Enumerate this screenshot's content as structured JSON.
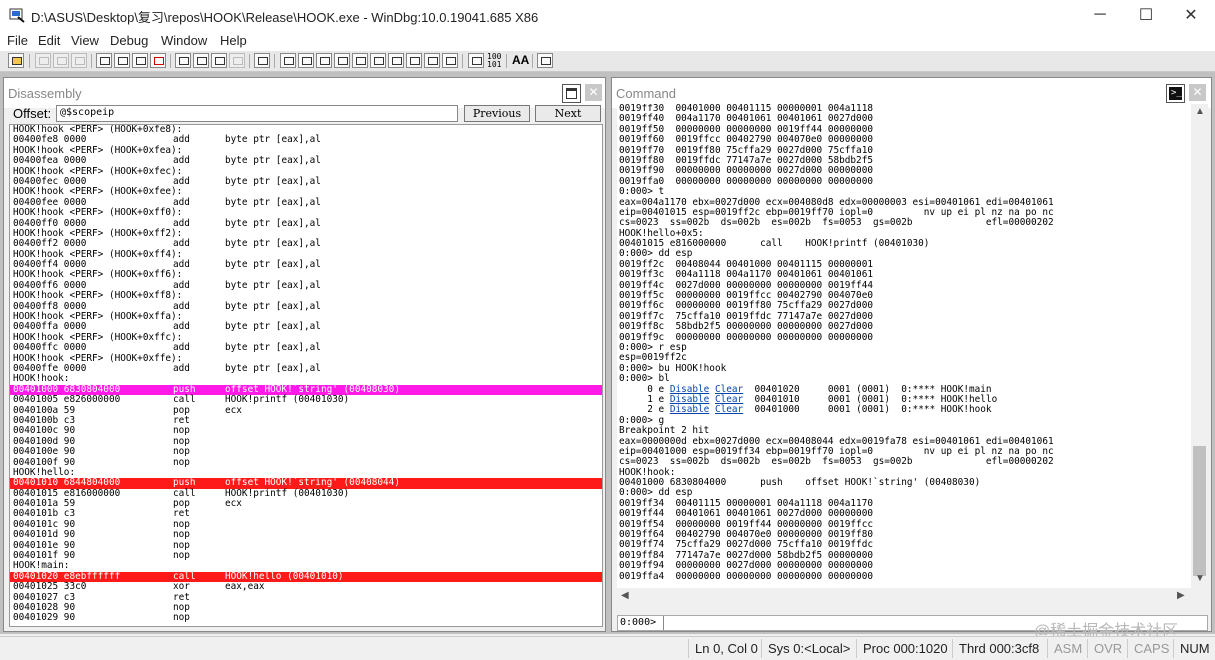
{
  "title": "D:\\ASUS\\Desktop\\复习\\repos\\HOOK\\Release\\HOOK.exe - WinDbg:10.0.19041.685 X86",
  "window_controls": {
    "minimize": "─",
    "maximize": "☐",
    "close": "✕"
  },
  "menu": [
    "File",
    "Edit",
    "View",
    "Debug",
    "Window",
    "Help"
  ],
  "toolbar_text": {
    "binary_top": "100",
    "binary_bottom": "101",
    "font_button": "AA"
  },
  "disassembly": {
    "title": "Disassembly",
    "offset_label": "Offset:",
    "offset_value": "@$scopeip",
    "previous_label": "Previous",
    "next_label": "Next",
    "lines": [
      {
        "t": "label",
        "text": "HOOK!hook <PERF> (HOOK+0xfe8):"
      },
      {
        "t": "code",
        "addr": "00400fe8 0000",
        "mn": "add",
        "op": "byte ptr [eax],al"
      },
      {
        "t": "label",
        "text": "HOOK!hook <PERF> (HOOK+0xfea):"
      },
      {
        "t": "code",
        "addr": "00400fea 0000",
        "mn": "add",
        "op": "byte ptr [eax],al"
      },
      {
        "t": "label",
        "text": "HOOK!hook <PERF> (HOOK+0xfec):"
      },
      {
        "t": "code",
        "addr": "00400fec 0000",
        "mn": "add",
        "op": "byte ptr [eax],al"
      },
      {
        "t": "label",
        "text": "HOOK!hook <PERF> (HOOK+0xfee):"
      },
      {
        "t": "code",
        "addr": "00400fee 0000",
        "mn": "add",
        "op": "byte ptr [eax],al"
      },
      {
        "t": "label",
        "text": "HOOK!hook <PERF> (HOOK+0xff0):"
      },
      {
        "t": "code",
        "addr": "00400ff0 0000",
        "mn": "add",
        "op": "byte ptr [eax],al"
      },
      {
        "t": "label",
        "text": "HOOK!hook <PERF> (HOOK+0xff2):"
      },
      {
        "t": "code",
        "addr": "00400ff2 0000",
        "mn": "add",
        "op": "byte ptr [eax],al"
      },
      {
        "t": "label",
        "text": "HOOK!hook <PERF> (HOOK+0xff4):"
      },
      {
        "t": "code",
        "addr": "00400ff4 0000",
        "mn": "add",
        "op": "byte ptr [eax],al"
      },
      {
        "t": "label",
        "text": "HOOK!hook <PERF> (HOOK+0xff6):"
      },
      {
        "t": "code",
        "addr": "00400ff6 0000",
        "mn": "add",
        "op": "byte ptr [eax],al"
      },
      {
        "t": "label",
        "text": "HOOK!hook <PERF> (HOOK+0xff8):"
      },
      {
        "t": "code",
        "addr": "00400ff8 0000",
        "mn": "add",
        "op": "byte ptr [eax],al"
      },
      {
        "t": "label",
        "text": "HOOK!hook <PERF> (HOOK+0xffa):"
      },
      {
        "t": "code",
        "addr": "00400ffa 0000",
        "mn": "add",
        "op": "byte ptr [eax],al"
      },
      {
        "t": "label",
        "text": "HOOK!hook <PERF> (HOOK+0xffc):"
      },
      {
        "t": "code",
        "addr": "00400ffc 0000",
        "mn": "add",
        "op": "byte ptr [eax],al"
      },
      {
        "t": "label",
        "text": "HOOK!hook <PERF> (HOOK+0xffe):"
      },
      {
        "t": "code",
        "addr": "00400ffe 0000",
        "mn": "add",
        "op": "byte ptr [eax],al"
      },
      {
        "t": "label",
        "text": "HOOK!hook:"
      },
      {
        "t": "code",
        "hl": "mag",
        "addr": "00401000 6830804000",
        "mn": "push",
        "op": "offset HOOK!`string' (00408030)"
      },
      {
        "t": "code",
        "addr": "00401005 e826000000",
        "mn": "call",
        "op": "HOOK!printf (00401030)"
      },
      {
        "t": "code",
        "addr": "0040100a 59",
        "mn": "pop",
        "op": "ecx"
      },
      {
        "t": "code",
        "addr": "0040100b c3",
        "mn": "ret",
        "op": ""
      },
      {
        "t": "code",
        "addr": "0040100c 90",
        "mn": "nop",
        "op": ""
      },
      {
        "t": "code",
        "addr": "0040100d 90",
        "mn": "nop",
        "op": ""
      },
      {
        "t": "code",
        "addr": "0040100e 90",
        "mn": "nop",
        "op": ""
      },
      {
        "t": "code",
        "addr": "0040100f 90",
        "mn": "nop",
        "op": ""
      },
      {
        "t": "label",
        "text": "HOOK!hello:"
      },
      {
        "t": "code",
        "hl": "red",
        "addr": "00401010 6844804000",
        "mn": "push",
        "op": "offset HOOK!`string' (00408044)"
      },
      {
        "t": "code",
        "addr": "00401015 e816000000",
        "mn": "call",
        "op": "HOOK!printf (00401030)"
      },
      {
        "t": "code",
        "addr": "0040101a 59",
        "mn": "pop",
        "op": "ecx"
      },
      {
        "t": "code",
        "addr": "0040101b c3",
        "mn": "ret",
        "op": ""
      },
      {
        "t": "code",
        "addr": "0040101c 90",
        "mn": "nop",
        "op": ""
      },
      {
        "t": "code",
        "addr": "0040101d 90",
        "mn": "nop",
        "op": ""
      },
      {
        "t": "code",
        "addr": "0040101e 90",
        "mn": "nop",
        "op": ""
      },
      {
        "t": "code",
        "addr": "0040101f 90",
        "mn": "nop",
        "op": ""
      },
      {
        "t": "label",
        "text": "HOOK!main:"
      },
      {
        "t": "code",
        "hl": "red",
        "addr": "00401020 e8ebffffff",
        "mn": "call",
        "op": "HOOK!hello (00401010)"
      },
      {
        "t": "code",
        "addr": "00401025 33c0",
        "mn": "xor",
        "op": "eax,eax"
      },
      {
        "t": "code",
        "addr": "00401027 c3",
        "mn": "ret",
        "op": ""
      },
      {
        "t": "code",
        "addr": "00401028 90",
        "mn": "nop",
        "op": ""
      },
      {
        "t": "code",
        "addr": "00401029 90",
        "mn": "nop",
        "op": ""
      }
    ]
  },
  "command": {
    "title": "Command",
    "prompt": "0:000>",
    "lines": [
      "0019ff30  00401000 00401115 00000001 004a1118",
      "0019ff40  004a1170 00401061 00401061 0027d000",
      "0019ff50  00000000 00000000 0019ff44 00000000",
      "0019ff60  0019ffcc 00402790 004070e0 00000000",
      "0019ff70  0019ff80 75cffa29 0027d000 75cffa10",
      "0019ff80  0019ffdc 77147a7e 0027d000 58bdb2f5",
      "0019ff90  00000000 00000000 0027d000 00000000",
      "0019ffa0  00000000 00000000 00000000 00000000",
      "0:000> t",
      "eax=004a1170 ebx=0027d000 ecx=004080d8 edx=00000003 esi=00401061 edi=00401061",
      "eip=00401015 esp=0019ff2c ebp=0019ff70 iopl=0         nv up ei pl nz na po nc",
      "cs=0023  ss=002b  ds=002b  es=002b  fs=0053  gs=002b             efl=00000202",
      "HOOK!hello+0x5:",
      "00401015 e816000000      call    HOOK!printf (00401030)",
      "0:000> dd esp",
      "0019ff2c  00408044 00401000 00401115 00000001",
      "0019ff3c  004a1118 004a1170 00401061 00401061",
      "0019ff4c  0027d000 00000000 00000000 0019ff44",
      "0019ff5c  00000000 0019ffcc 00402790 004070e0",
      "0019ff6c  00000000 0019ff80 75cffa29 0027d000",
      "0019ff7c  75cffa10 0019ffdc 77147a7e 0027d000",
      "0019ff8c  58bdb2f5 00000000 00000000 0027d000",
      "0019ff9c  00000000 00000000 00000000 00000000",
      "0:000> r esp",
      "esp=0019ff2c",
      "0:000> bu HOOK!hook",
      "0:000> bl",
      {
        "bp": true,
        "pre": "     0 e ",
        "d": "Disable",
        "c": "Clear",
        "post": "  00401020     0001 (0001)  0:**** HOOK!main"
      },
      {
        "bp": true,
        "pre": "     1 e ",
        "d": "Disable",
        "c": "Clear",
        "post": "  00401010     0001 (0001)  0:**** HOOK!hello"
      },
      {
        "bp": true,
        "pre": "     2 e ",
        "d": "Disable",
        "c": "Clear",
        "post": "  00401000     0001 (0001)  0:**** HOOK!hook"
      },
      "0:000> g",
      "Breakpoint 2 hit",
      "eax=0000000d ebx=0027d000 ecx=00408044 edx=0019fa78 esi=00401061 edi=00401061",
      "eip=00401000 esp=0019ff34 ebp=0019ff70 iopl=0         nv up ei pl nz na po nc",
      "cs=0023  ss=002b  ds=002b  es=002b  fs=0053  gs=002b             efl=00000202",
      "HOOK!hook:",
      "00401000 6830804000      push    offset HOOK!`string' (00408030)",
      "0:000> dd esp",
      "0019ff34  00401115 00000001 004a1118 004a1170",
      "0019ff44  00401061 00401061 0027d000 00000000",
      "0019ff54  00000000 0019ff44 00000000 0019ffcc",
      "0019ff64  00402790 004070e0 00000000 0019ff80",
      "0019ff74  75cffa29 0027d000 75cffa10 0019ffdc",
      "0019ff84  77147a7e 0027d000 58bdb2f5 00000000",
      "0019ff94  00000000 0027d000 00000000 00000000",
      "0019ffa4  00000000 00000000 00000000 00000000"
    ]
  },
  "watermark": "@稀土掘金技术社区",
  "status": {
    "pos": "Ln 0, Col 0",
    "sys": "Sys 0:<Local>",
    "proc": "Proc 000:1020",
    "thrd": "Thrd 000:3cf8",
    "asm": "ASM",
    "ovr": "OVR",
    "caps": "CAPS",
    "num": "NUM"
  }
}
